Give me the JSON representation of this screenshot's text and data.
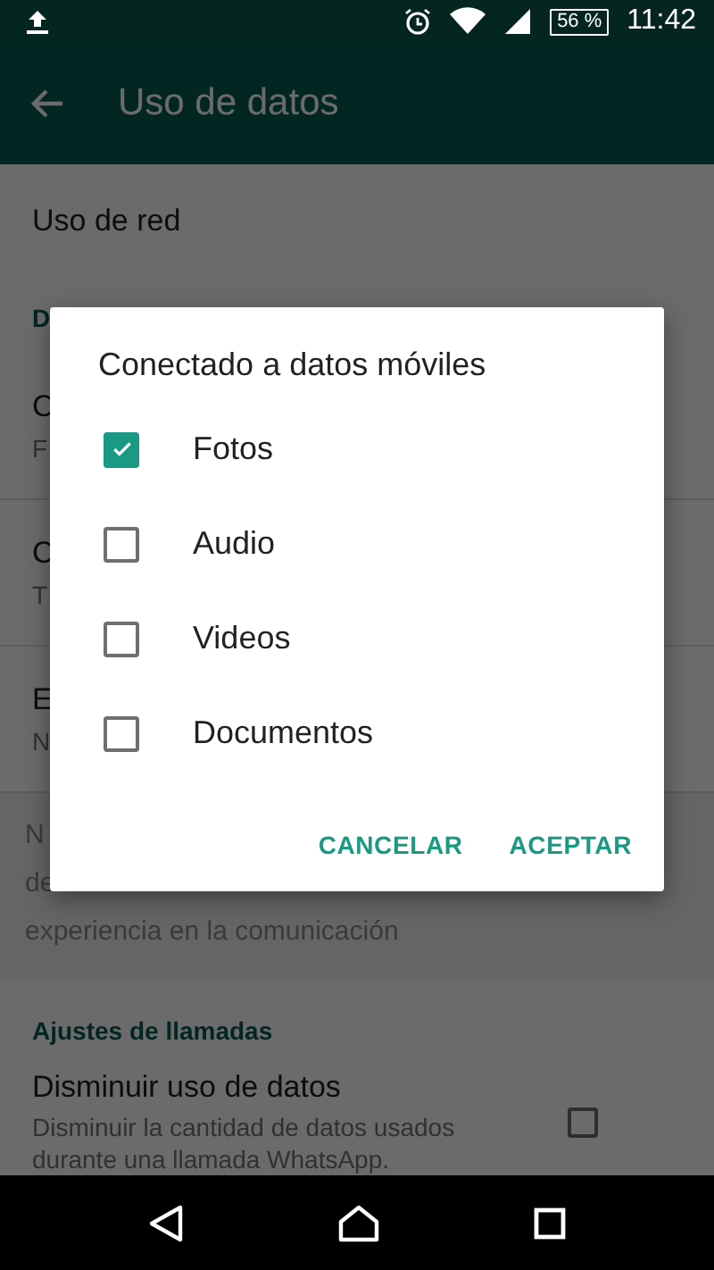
{
  "status_bar": {
    "battery": "56 %",
    "time": "11:42"
  },
  "toolbar": {
    "title": "Uso de datos"
  },
  "settings": [
    {
      "kind": "item",
      "title": "Uso de red"
    },
    {
      "kind": "header",
      "title": "D"
    },
    {
      "kind": "item",
      "title": "C",
      "subtitle": "F"
    },
    {
      "kind": "item",
      "title": "C",
      "subtitle": "T"
    },
    {
      "kind": "item",
      "title": "E",
      "subtitle": "N"
    },
    {
      "kind": "note",
      "lines": [
        "N",
        "de",
        "experiencia en la comunicación"
      ]
    },
    {
      "kind": "header",
      "title": "Ajustes de llamadas"
    },
    {
      "kind": "checkbox",
      "title": "Disminuir uso de datos",
      "subtitle": "Disminuir la cantidad de datos usados durante una llamada WhatsApp.",
      "checked": false
    }
  ],
  "dialog": {
    "title": "Conectado a datos móviles",
    "options": [
      {
        "label": "Fotos",
        "checked": true
      },
      {
        "label": "Audio",
        "checked": false
      },
      {
        "label": "Videos",
        "checked": false
      },
      {
        "label": "Documentos",
        "checked": false
      }
    ],
    "buttons": [
      "CANCELAR",
      "ACEPTAR"
    ]
  }
}
